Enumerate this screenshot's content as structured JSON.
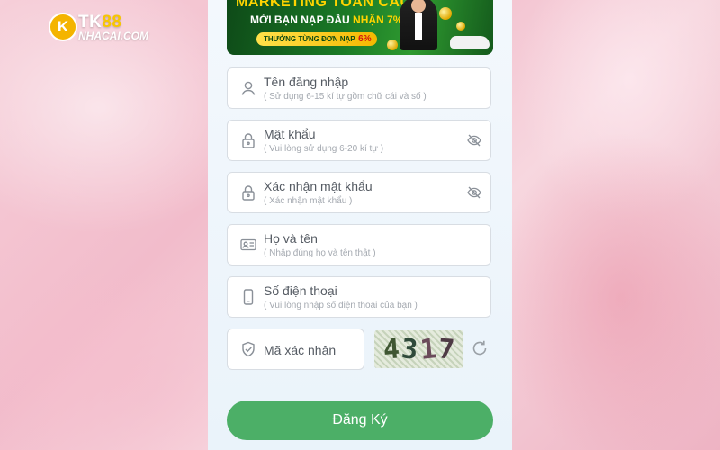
{
  "logo": {
    "mark": "K",
    "brand_a": "TK",
    "brand_b": "88",
    "sub": "NHACAI.COM"
  },
  "banner": {
    "line1": "MARKETING TOÀN CẦU",
    "line2_a": "MỜI BẠN NẠP ĐẦU ",
    "line2_b": "NHẬN 7%",
    "line3": "THƯỞNG TỪNG ĐƠN NẠP",
    "line3_pct": "6%"
  },
  "form": {
    "fields": [
      {
        "label": "Tên đăng nhập",
        "hint": "( Sử dụng 6-15 kí tự gồm chữ cái và số )",
        "icon": "user-icon"
      },
      {
        "label": "Mật khẩu",
        "hint": "( Vui lòng sử dụng 6-20 kí tự )",
        "icon": "lock-icon"
      },
      {
        "label": "Xác nhận mật khẩu",
        "hint": "( Xác nhận mật khẩu )",
        "icon": "lock-icon"
      },
      {
        "label": "Họ và tên",
        "hint": "( Nhập đúng họ và tên thật )",
        "icon": "id-card-icon"
      },
      {
        "label": "Số điện thoại",
        "hint": "( Vui lòng nhập số điện thoại của bạn )",
        "icon": "phone-icon"
      }
    ],
    "captcha": {
      "label": "Mã xác nhận",
      "code": [
        "4",
        "3",
        "1",
        "7"
      ],
      "icon": "shield-check-icon"
    },
    "submit_label": "Đăng Ký"
  },
  "colors": {
    "accent": "#4caf67",
    "banner_green": "#1b7a26",
    "banner_gold": "#ffd400"
  }
}
